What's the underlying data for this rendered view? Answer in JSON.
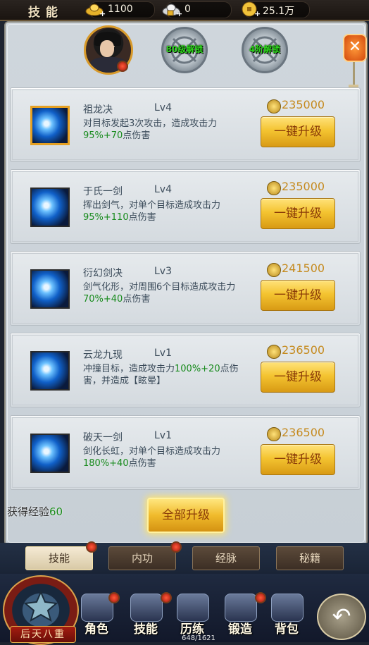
{
  "top": {
    "title": "技能",
    "resources": [
      {
        "icon": "gold-ingot-icon",
        "value": "1100"
      },
      {
        "icon": "bound-ingot-icon",
        "value": "0"
      },
      {
        "icon": "coin-icon",
        "value": "25.1万"
      }
    ]
  },
  "slots": [
    {
      "label": ""
    },
    {
      "label": "80级解锁"
    },
    {
      "label": "4阶解锁"
    }
  ],
  "skills": [
    {
      "name": "祖龙决",
      "level": "Lv4",
      "desc_a": "对目标发起3次攻击，造成攻击力",
      "desc_hl": "95%+70",
      "desc_b": "点伤害",
      "cost": "235000",
      "button": "一键升级"
    },
    {
      "name": "于氏一剑",
      "level": "Lv4",
      "desc_a": "挥出剑气，对单个目标造成攻击力",
      "desc_hl": "95%+110",
      "desc_b": "点伤害",
      "cost": "235000",
      "button": "一键升级"
    },
    {
      "name": "衍幻剑决",
      "level": "Lv3",
      "desc_a": "剑气化形，对周围6个目标造成攻击力",
      "desc_hl": "70%+40",
      "desc_b": "点伤害",
      "cost": "241500",
      "button": "一键升级"
    },
    {
      "name": "云龙九现",
      "level": "Lv1",
      "desc_a": "冲撞目标，造成攻击力",
      "desc_hl": "100%+20",
      "desc_b": "点伤害，并造成【眩晕】",
      "cost": "236500",
      "button": "一键升级"
    },
    {
      "name": "破天一剑",
      "level": "Lv1",
      "desc_a": "剑化长虹，对单个目标造成攻击力",
      "desc_hl": "180%+40",
      "desc_b": "点伤害",
      "cost": "236500",
      "button": "一键升级"
    }
  ],
  "footer": {
    "exp_label": "获得经验",
    "exp_value": "60",
    "all_upgrade": "全部升级"
  },
  "tabs": [
    "技能",
    "内功",
    "经脉",
    "秘籍"
  ],
  "nav": {
    "emblem_label": "后天八重",
    "items": [
      "角色",
      "技能",
      "历练",
      "锻造",
      "背包"
    ],
    "progress": "648/1621"
  }
}
